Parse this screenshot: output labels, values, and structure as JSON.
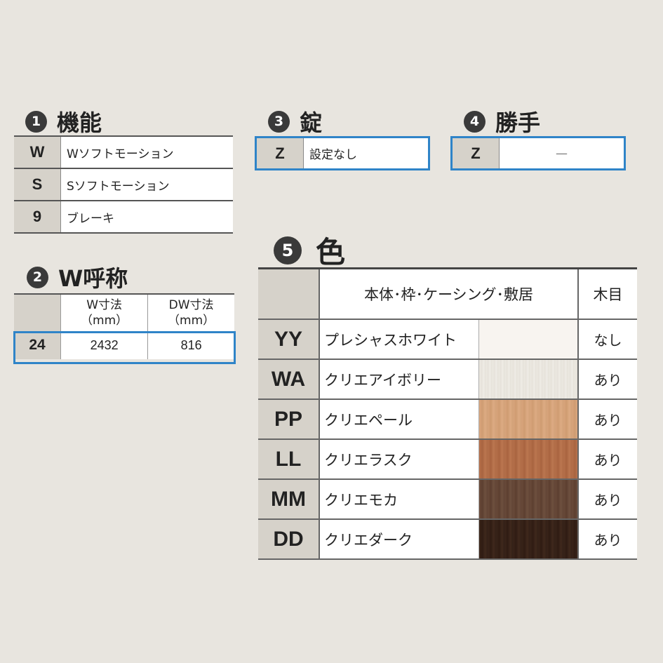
{
  "sections": {
    "function": {
      "num": "1",
      "title": "機能",
      "rows": [
        {
          "code": "W",
          "label": "Wソフトモーション"
        },
        {
          "code": "S",
          "label": "Sソフトモーション"
        },
        {
          "code": "9",
          "label": "ブレーキ"
        }
      ]
    },
    "w_nominal": {
      "num": "2",
      "title": "W呼称",
      "headers": [
        {
          "line1": "W寸法",
          "line2": "（mm）"
        },
        {
          "line1": "DW寸法",
          "line2": "（mm）"
        }
      ],
      "row": {
        "code": "24",
        "w": "2432",
        "dw": "816"
      }
    },
    "lock": {
      "num": "3",
      "title": "錠",
      "code": "Z",
      "label": "設定なし"
    },
    "handing": {
      "num": "4",
      "title": "勝手",
      "code": "Z",
      "label": "—"
    },
    "color": {
      "num": "5",
      "title": "色",
      "header_body": "本体･枠･ケーシング･敷居",
      "header_grain": "木目",
      "rows": [
        {
          "code": "YY",
          "name": "プレシャスホワイト",
          "grain": "なし",
          "swatch": "#f8f4f0"
        },
        {
          "code": "WA",
          "name": "クリエアイボリー",
          "grain": "あり",
          "swatch": "#eae6df"
        },
        {
          "code": "PP",
          "name": "クリエペール",
          "grain": "あり",
          "swatch": "#d6a37a"
        },
        {
          "code": "LL",
          "name": "クリエラスク",
          "grain": "あり",
          "swatch": "#b26d47"
        },
        {
          "code": "MM",
          "name": "クリエモカ",
          "grain": "あり",
          "swatch": "#654838"
        },
        {
          "code": "DD",
          "name": "クリエダーク",
          "grain": "あり",
          "swatch": "#36221a"
        }
      ]
    }
  },
  "colors": {
    "highlight_border": "#2f84c8",
    "code_cell": "#d6d2ca",
    "background": "#e8e5df"
  }
}
